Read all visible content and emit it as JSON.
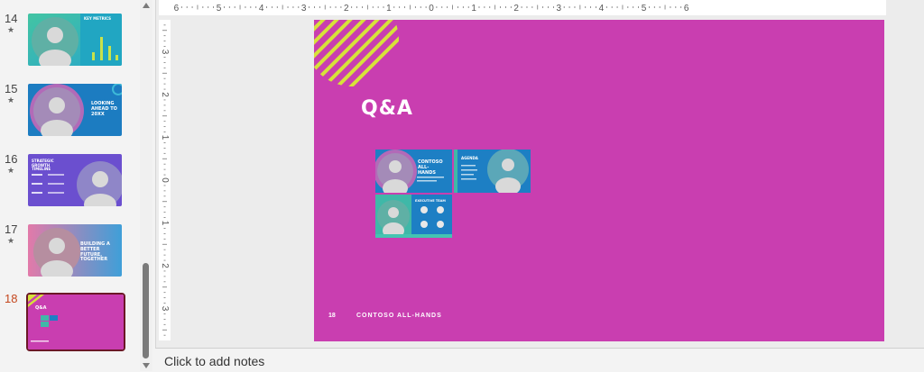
{
  "thumbnails": [
    {
      "number": "14",
      "star": "★",
      "title": "KEY METRICS"
    },
    {
      "number": "15",
      "star": "★",
      "title": "LOOKING AHEAD TO 20XX"
    },
    {
      "number": "16",
      "star": "★",
      "title": "STRATEGIC GROWTH TIMELINE"
    },
    {
      "number": "17",
      "star": "★",
      "title": "BUILDING A BETTER FUTURE, TOGETHER"
    },
    {
      "number": "18",
      "star": "",
      "title": "Q&A"
    }
  ],
  "ruler": {
    "horizontal": [
      "6",
      "5",
      "4",
      "3",
      "2",
      "1",
      "0",
      "1",
      "2",
      "3",
      "4",
      "5",
      "6"
    ],
    "vertical": [
      "3",
      "2",
      "1",
      "0",
      "1",
      "2",
      "3"
    ]
  },
  "slide": {
    "title": "Q&A",
    "footer_number": "18",
    "footer_text": "CONTOSO ALL-HANDS",
    "mini_slides": {
      "cover": "CONTOSO ALL-HANDS",
      "agenda": "AGENDA",
      "team": "EXECUTIVE TEAM"
    }
  },
  "notes": {
    "placeholder": "Click to add notes"
  },
  "colors": {
    "slide_bg": "#c93eb0",
    "accent_yellow": "#d7e23a",
    "teal": "#3fb8a8",
    "blue": "#1d7fc4",
    "purple": "#6b4fcf",
    "selection": "#6b1726"
  }
}
